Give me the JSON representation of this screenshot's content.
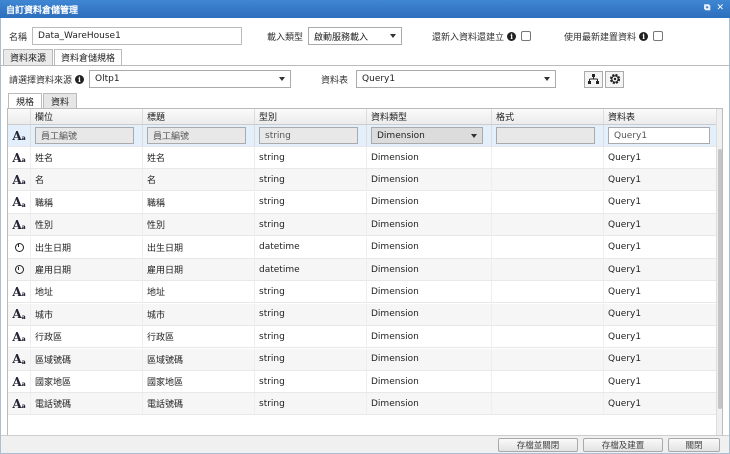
{
  "window": {
    "title": "自訂資料倉儲管理",
    "icon_restore": "⧉",
    "icon_close": "✕"
  },
  "top": {
    "name_label": "名稱",
    "name_value": "Data_WareHouse1",
    "load_type_label": "載入類型",
    "load_type_value": "啟動服務載入",
    "reimport_label": "還新入資料還建立",
    "latest_label": "使用最新建置資料"
  },
  "tabs": [
    "資料來源",
    "資料倉儲規格"
  ],
  "source": {
    "source_label": "請選擇資料來源",
    "source_value": "Oltp1",
    "table_label": "資料表",
    "table_value": "Query1"
  },
  "subtabs": [
    "規格",
    "資料"
  ],
  "grid": {
    "columns": [
      "欄位",
      "標題",
      "型別",
      "資料類型",
      "格式",
      "資料表"
    ],
    "filter": {
      "field": "員工編號",
      "caption": "員工編號",
      "type": "string",
      "data_type": "Dimension",
      "format": "",
      "table": "Query1"
    },
    "rows": [
      {
        "icon": "text-type-icon",
        "field": "姓名",
        "caption": "姓名",
        "type": "string",
        "data_type": "Dimension",
        "format": "",
        "table": "Query1"
      },
      {
        "icon": "text-type-icon",
        "field": "名",
        "caption": "名",
        "type": "string",
        "data_type": "Dimension",
        "format": "",
        "table": "Query1"
      },
      {
        "icon": "text-type-icon",
        "field": "職稱",
        "caption": "職稱",
        "type": "string",
        "data_type": "Dimension",
        "format": "",
        "table": "Query1"
      },
      {
        "icon": "text-type-icon",
        "field": "性別",
        "caption": "性別",
        "type": "string",
        "data_type": "Dimension",
        "format": "",
        "table": "Query1"
      },
      {
        "icon": "clock-icon",
        "field": "出生日期",
        "caption": "出生日期",
        "type": "datetime",
        "data_type": "Dimension",
        "format": "",
        "table": "Query1"
      },
      {
        "icon": "clock-icon",
        "field": "雇用日期",
        "caption": "雇用日期",
        "type": "datetime",
        "data_type": "Dimension",
        "format": "",
        "table": "Query1"
      },
      {
        "icon": "text-type-icon",
        "field": "地址",
        "caption": "地址",
        "type": "string",
        "data_type": "Dimension",
        "format": "",
        "table": "Query1"
      },
      {
        "icon": "text-type-icon",
        "field": "城市",
        "caption": "城市",
        "type": "string",
        "data_type": "Dimension",
        "format": "",
        "table": "Query1"
      },
      {
        "icon": "text-type-icon",
        "field": "行政區",
        "caption": "行政區",
        "type": "string",
        "data_type": "Dimension",
        "format": "",
        "table": "Query1"
      },
      {
        "icon": "text-type-icon",
        "field": "區域號碼",
        "caption": "區域號碼",
        "type": "string",
        "data_type": "Dimension",
        "format": "",
        "table": "Query1"
      },
      {
        "icon": "text-type-icon",
        "field": "國家地區",
        "caption": "國家地區",
        "type": "string",
        "data_type": "Dimension",
        "format": "",
        "table": "Query1"
      },
      {
        "icon": "text-type-icon",
        "field": "電話號碼",
        "caption": "電話號碼",
        "type": "string",
        "data_type": "Dimension",
        "format": "",
        "table": "Query1"
      }
    ]
  },
  "footer": {
    "save_close": "存檔並關閉",
    "save_build": "存檔及建置",
    "close": "關閉"
  }
}
